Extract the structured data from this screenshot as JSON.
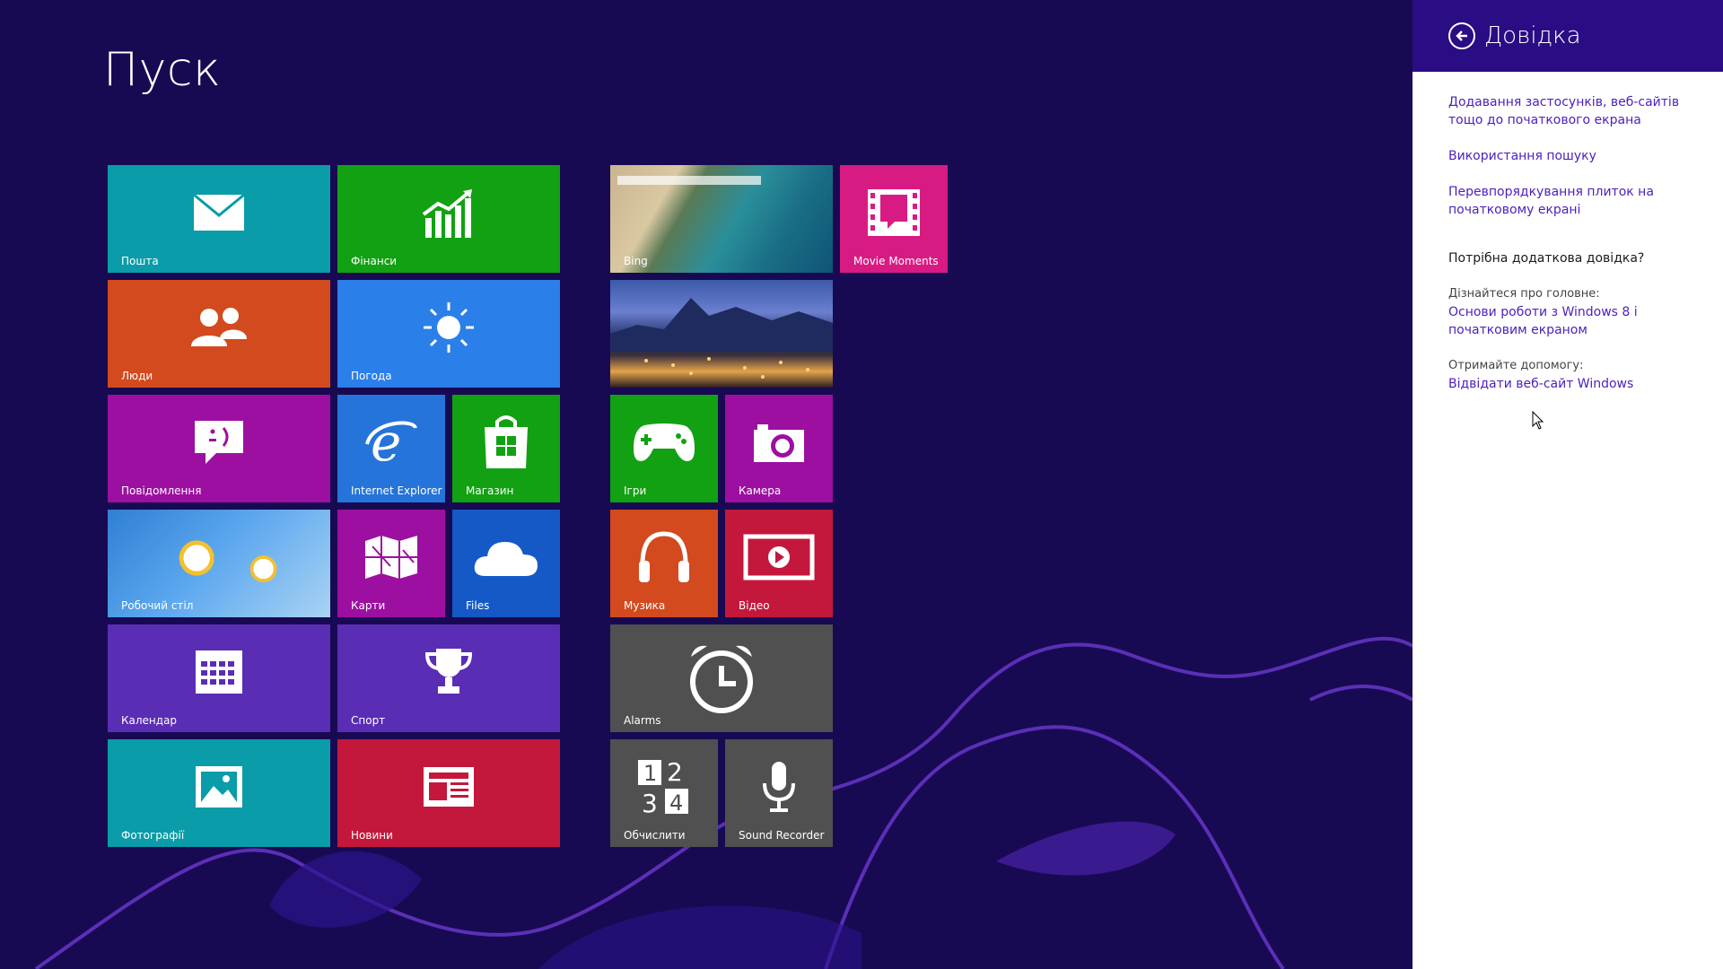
{
  "start": {
    "title": "Пуск",
    "tiles": [
      {
        "label": "Пошта",
        "color": "#0a9ca8",
        "icon": "mail-icon"
      },
      {
        "label": "Фінанси",
        "color": "#12a112",
        "icon": "finance-icon"
      },
      {
        "label": "Люди",
        "color": "#d24a1d",
        "icon": "people-icon"
      },
      {
        "label": "Погода",
        "color": "#2b7fe8",
        "icon": "sun-icon"
      },
      {
        "label": "Повідомлення",
        "color": "#9c0fa0",
        "icon": "messaging-icon"
      },
      {
        "label": "Internet Explorer",
        "color": "#2574d9",
        "icon": "ie-icon"
      },
      {
        "label": "Магазин",
        "color": "#12a112",
        "icon": "store-icon"
      },
      {
        "label": "Робочий стіл",
        "color": "#3b86d6",
        "icon": "desktop-photo"
      },
      {
        "label": "Карти",
        "color": "#9c0fa0",
        "icon": "maps-icon"
      },
      {
        "label": "Files",
        "color": "#1559c6",
        "icon": "cloud-icon"
      },
      {
        "label": "Календар",
        "color": "#5a2db5",
        "icon": "calendar-icon"
      },
      {
        "label": "Спорт",
        "color": "#5a2db5",
        "icon": "trophy-icon"
      },
      {
        "label": "Фотографії",
        "color": "#0a9ca8",
        "icon": "photos-icon"
      },
      {
        "label": "Новини",
        "color": "#c3183b",
        "icon": "news-icon"
      },
      {
        "label": "Bing",
        "color": "#2a8f9a",
        "icon": "bing-photo"
      },
      {
        "label": "Movie Moments",
        "color": "#d81b82",
        "icon": "movie-icon"
      },
      {
        "label": "",
        "color": "#3b5aa8",
        "icon": "travel-photo"
      },
      {
        "label": "Ігри",
        "color": "#12a112",
        "icon": "gamepad-icon"
      },
      {
        "label": "Камера",
        "color": "#9c0fa0",
        "icon": "camera-icon"
      },
      {
        "label": "Музика",
        "color": "#d24a1d",
        "icon": "headphones-icon"
      },
      {
        "label": "Відео",
        "color": "#c3183b",
        "icon": "video-icon"
      },
      {
        "label": "Alarms",
        "color": "#505050",
        "icon": "alarm-icon"
      },
      {
        "label": "Обчислити",
        "color": "#505050",
        "icon": "calculator-icon"
      },
      {
        "label": "Sound Recorder",
        "color": "#505050",
        "icon": "microphone-icon"
      }
    ]
  },
  "help": {
    "title": "Довідка",
    "links": [
      "Додавання застосунків, веб-сайтів тощо до початкового екрана",
      "Використання пошуку",
      "Перевпорядкування плиток на початковому екрані"
    ],
    "more_heading": "Потрібна додаткова довідка?",
    "learn_label": "Дізнайтеся про головне:",
    "learn_link": "Основи роботи з Windows 8 і початковим екраном",
    "support_label": "Отримайте допомогу:",
    "support_link": "Відвідати веб-сайт Windows"
  }
}
